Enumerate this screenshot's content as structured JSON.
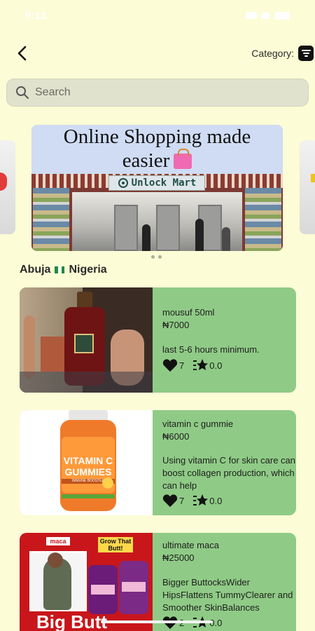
{
  "statusbar": {
    "time": "9:13"
  },
  "header": {
    "category_label": "Category:"
  },
  "search": {
    "placeholder": "Search"
  },
  "banner": {
    "title_line1": "Online Shopping made",
    "title_line2": "easier",
    "store_name": "Unlock Mart"
  },
  "location": {
    "city": "Abuja",
    "country": "Nigeria"
  },
  "products": [
    {
      "name": "mousuf 50ml",
      "price": "₦7000",
      "description": "last 5-6 hours minimum.",
      "likes": "7",
      "rating": "0.0"
    },
    {
      "name": "vitamin c gummie",
      "price": "₦6000",
      "description": "Using vitamin C for skin care can boost collagen production, which can help",
      "likes": "7",
      "rating": "0.0",
      "image_text": {
        "top": "VITAMIN C",
        "bottom": "GUMMIES",
        "badge": "IMMUNE BOOSTER"
      }
    },
    {
      "name": "ultimate maca",
      "price": "₦25000",
      "description": "Bigger ButtocksWider HipsFlattens TummyClearer and Smoother SkinBalances",
      "likes": "2",
      "rating": "0.0",
      "image_text": {
        "brand": "maca",
        "grow": "Grow That Butt!",
        "big": "Big Butt"
      }
    }
  ],
  "colors": {
    "background": "#fcfcd6",
    "card": "#8fcb86",
    "search": "#e1e2cd"
  }
}
